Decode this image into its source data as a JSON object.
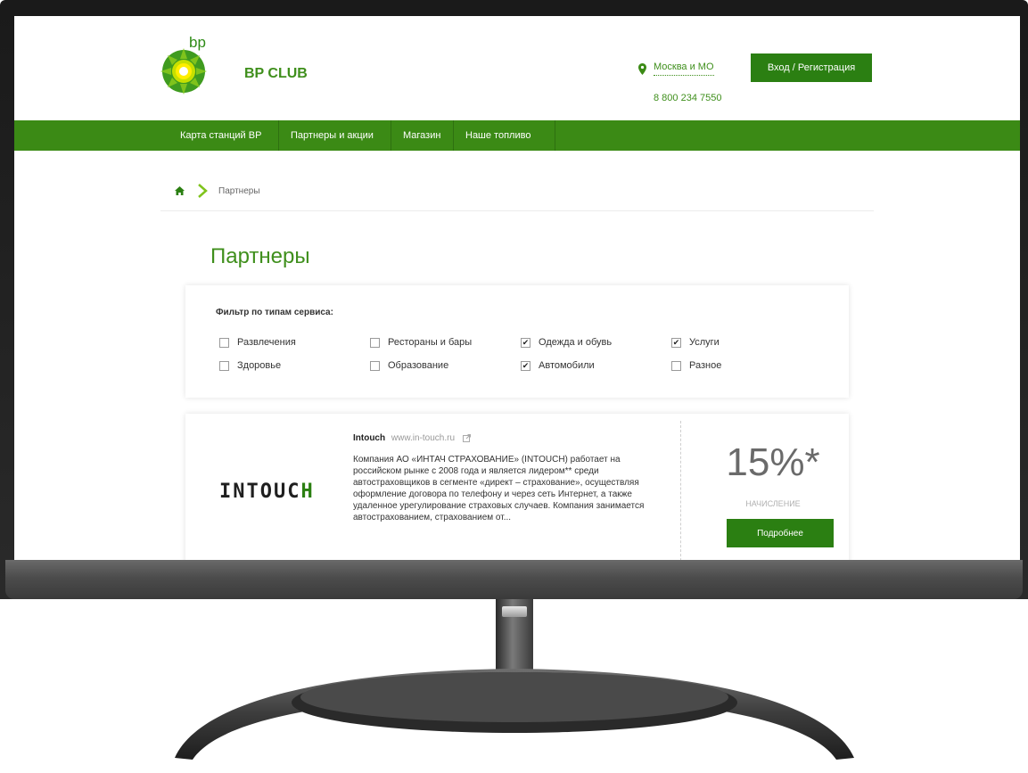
{
  "header": {
    "logo_text": "bp",
    "brand": "BP CLUB",
    "city": "Москва и МО",
    "phone": "8 800 234 7550",
    "login_label": "Вход / Регистрация"
  },
  "nav": {
    "items": [
      {
        "label": "Карта станций BP"
      },
      {
        "label": "Партнеры и акции"
      },
      {
        "label": "Магазин"
      },
      {
        "label": "Наше топливо"
      }
    ]
  },
  "breadcrumb": {
    "current": "Партнеры"
  },
  "page": {
    "title": "Партнеры"
  },
  "filter": {
    "title": "Фильтр по типам сервиса:",
    "options": [
      {
        "label": "Развлечения",
        "checked": false
      },
      {
        "label": "Рестораны и бары",
        "checked": false
      },
      {
        "label": "Одежда и обувь",
        "checked": true
      },
      {
        "label": "Услуги",
        "checked": true
      },
      {
        "label": "Здоровье",
        "checked": false
      },
      {
        "label": "Образование",
        "checked": false
      },
      {
        "label": "Автомобили",
        "checked": true
      },
      {
        "label": "Разное",
        "checked": false
      }
    ]
  },
  "partner": {
    "logo_main": "INTOUC",
    "logo_accent": "H",
    "name": "Intouch",
    "link": "www.in-touch.ru",
    "description": "Компания АО «ИНТАЧ СТРАХОВАНИЕ» (INTOUCH) работает на российском рынке с 2008 года и является лидером** среди автостраховщиков в сегменте «директ – страхование», осуществляя оформление договора по телефону и через сеть Интернет, а также удаленное урегулирование страховых случаев. Компания занимается автострахованием, страхованием от...",
    "discount": "15%*",
    "discount_label": "НАЧИСЛЕНИЕ",
    "more_label": "Подробнее"
  },
  "colors": {
    "brand_green": "#3b8a15",
    "button_green": "#2b7f12",
    "bezel": "#1a1a1a"
  },
  "icons": [
    "bp-helios-logo",
    "map-pin-icon",
    "home-icon",
    "chevron-right-icon",
    "external-link-icon",
    "checkbox-icon"
  ]
}
